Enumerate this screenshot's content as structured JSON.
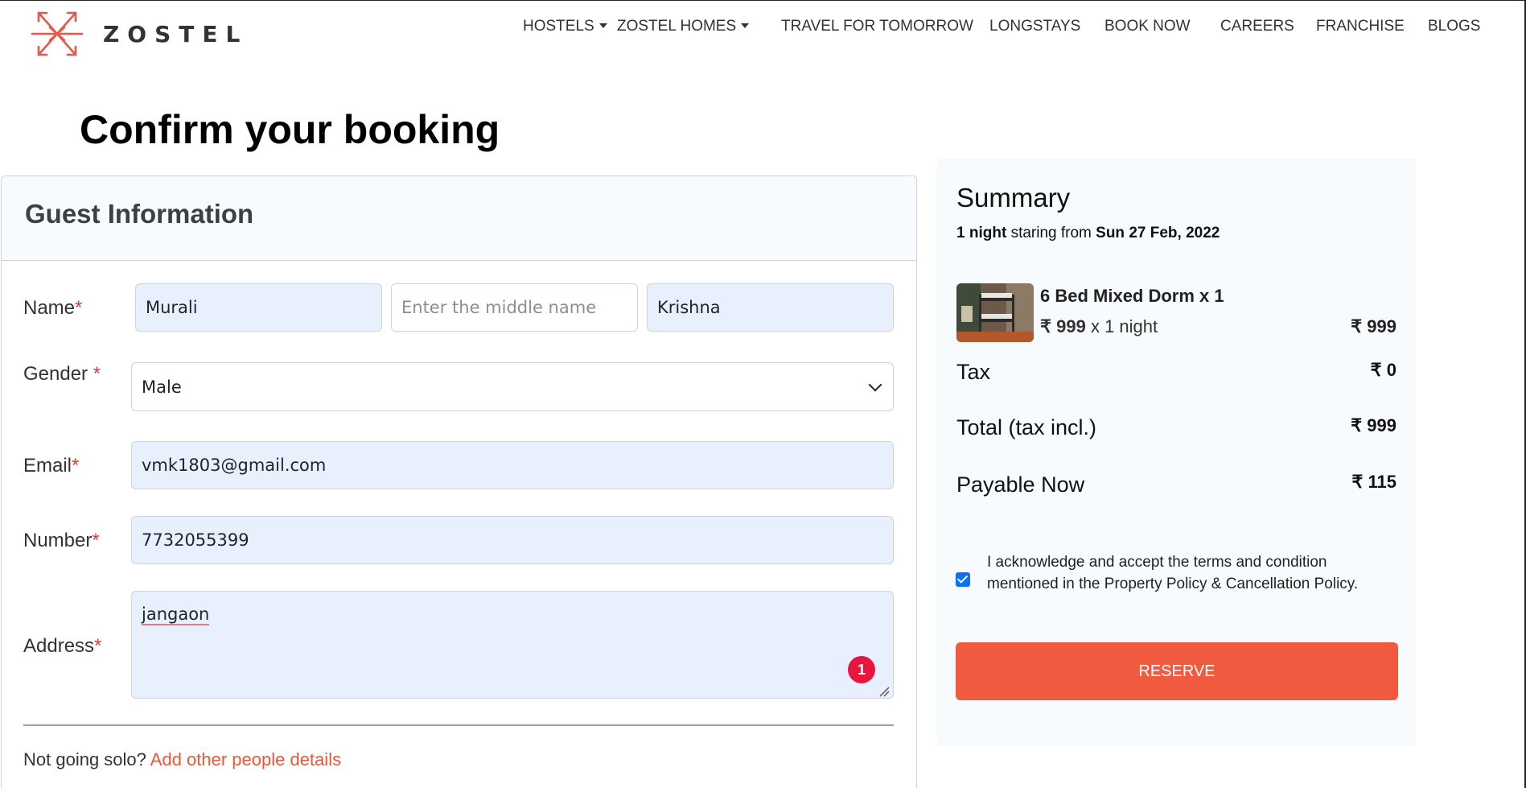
{
  "brand": {
    "name": "ZOSTEL",
    "accent": "#f05a3e"
  },
  "nav": {
    "items": [
      {
        "label": "HOSTELS",
        "dropdown": true
      },
      {
        "label": "ZOSTEL HOMES",
        "dropdown": true
      },
      {
        "label": "TRAVEL FOR TOMORROW",
        "dropdown": false
      },
      {
        "label": "LONGSTAYS",
        "dropdown": false
      },
      {
        "label": "BOOK NOW",
        "dropdown": false
      },
      {
        "label": "CAREERS",
        "dropdown": false
      },
      {
        "label": "FRANCHISE",
        "dropdown": false
      },
      {
        "label": "BLOGS",
        "dropdown": false
      }
    ]
  },
  "page": {
    "title": "Confirm your booking"
  },
  "guest": {
    "title": "Guest Information",
    "required_mark": "*",
    "name": {
      "label": "Name",
      "first": "Murali",
      "middle_placeholder": "Enter the middle name",
      "last": "Krishna"
    },
    "gender": {
      "label": "Gender",
      "value": "Male"
    },
    "email": {
      "label": "Email",
      "value": "vmk1803@gmail.com"
    },
    "number": {
      "label": "Number",
      "value": "7732055399"
    },
    "address": {
      "label": "Address",
      "value": "jangaon",
      "badge": "1"
    },
    "solo": {
      "text": "Not going solo?",
      "link": "Add other people details"
    }
  },
  "summary": {
    "title": "Summary",
    "nights": "1 night",
    "staring_from": "staring from",
    "date": "Sun 27 Feb, 2022",
    "room": {
      "name": "6 Bed Mixed Dorm x 1",
      "rate": "₹ 999",
      "rate_suffix": "x 1 night",
      "price": "₹ 999"
    },
    "tax": {
      "label": "Tax",
      "value": "₹ 0"
    },
    "total": {
      "label": "Total (tax incl.)",
      "value": "₹ 999"
    },
    "payable": {
      "label": "Payable Now",
      "value": "₹ 115"
    },
    "terms": "I acknowledge and accept the terms and condition mentioned in the Property Policy & Cancellation Policy.",
    "terms_checked": true,
    "reserve_label": "RESERVE"
  }
}
